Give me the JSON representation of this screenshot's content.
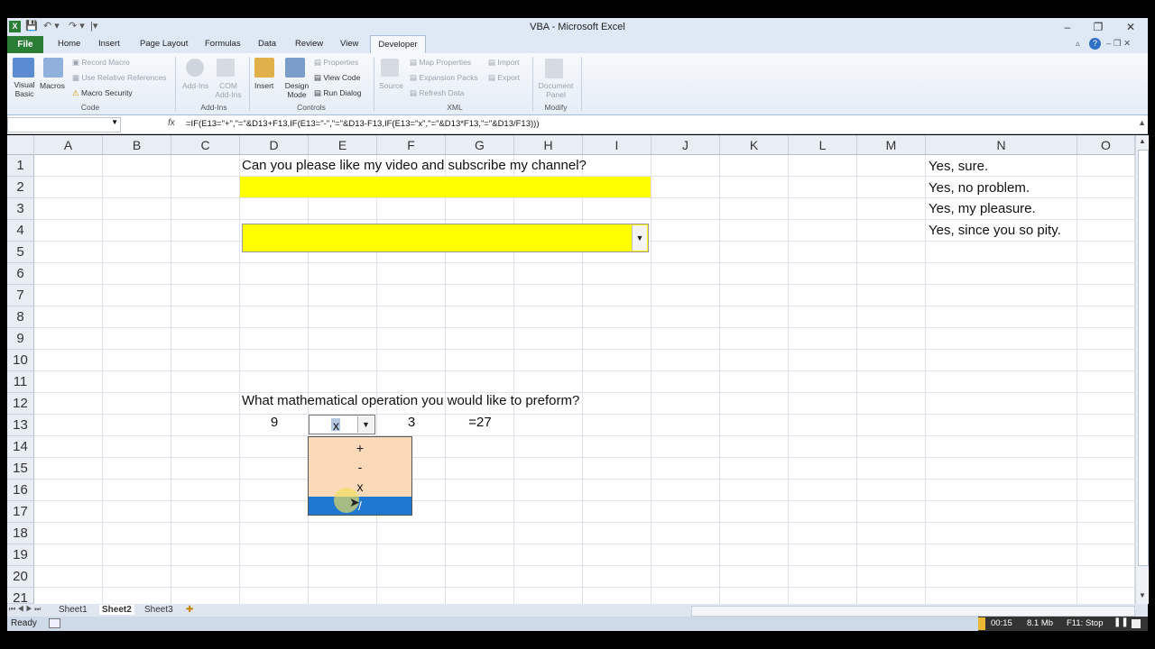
{
  "app": {
    "title": "VBA  -  Microsoft Excel",
    "tabs": [
      "File",
      "Home",
      "Insert",
      "Page Layout",
      "Formulas",
      "Data",
      "Review",
      "View",
      "Developer"
    ]
  },
  "ribbon": {
    "code": {
      "visual_basic": "Visual Basic",
      "macros": "Macros",
      "record_macro": "Record Macro",
      "relative_refs": "Use Relative References",
      "macro_security": "Macro Security",
      "group": "Code"
    },
    "addins": {
      "addins": "Add-Ins",
      "com_addins": "COM Add-Ins",
      "group": "Add-Ins"
    },
    "controls": {
      "insert": "Insert",
      "design_mode": "Design Mode",
      "properties": "Properties",
      "view_code": "View Code",
      "run_dialog": "Run Dialog",
      "group": "Controls"
    },
    "xml": {
      "source": "Source",
      "map_properties": "Map Properties",
      "expansion_packs": "Expansion Packs",
      "refresh_data": "Refresh Data",
      "import": "Import",
      "export": "Export",
      "group": "XML"
    },
    "modify": {
      "document_panel": "Document Panel",
      "group": "Modify"
    }
  },
  "formula_bar": {
    "fx": "fx",
    "formula": "=IF(E13=\"+\",\"=\"&D13+F13,IF(E13=\"-\",\"=\"&D13-F13,IF(E13=\"x\",\"=\"&D13*F13,\"=\"&D13/F13)))"
  },
  "columns": [
    "A",
    "B",
    "C",
    "D",
    "E",
    "F",
    "G",
    "H",
    "I",
    "J",
    "K",
    "L",
    "M",
    "N",
    "O"
  ],
  "rows": [
    "1",
    "2",
    "3",
    "4",
    "5",
    "6",
    "7",
    "8",
    "9",
    "10",
    "11",
    "12",
    "13",
    "14",
    "15",
    "16",
    "17",
    "18",
    "19",
    "20",
    "21"
  ],
  "cells": {
    "d1": "Can you please like my video and subscribe my channel?",
    "n1": "Yes, sure.",
    "n2": "Yes, no problem.",
    "n3": "Yes, my pleasure.",
    "n4": "Yes, since you so pity.",
    "d12": "What mathematical operation you would like to preform?",
    "d13": "9",
    "e13": "x",
    "f13": "3",
    "g13": "=27"
  },
  "dropdown": {
    "options": [
      "+",
      "-",
      "x",
      "/"
    ],
    "selected": "/"
  },
  "colors": {
    "yellow": "#ffff00",
    "dropdown_bg": "#fcd9b8",
    "selection": "#1f79d2",
    "file_tab": "#2a7d34"
  },
  "sheets": [
    "Sheet1",
    "Sheet2",
    "Sheet3"
  ],
  "active_sheet": "Sheet2",
  "status": {
    "ready": "Ready",
    "time": "00:15",
    "size": "8.1 Mb",
    "stop": "F11: Stop"
  }
}
